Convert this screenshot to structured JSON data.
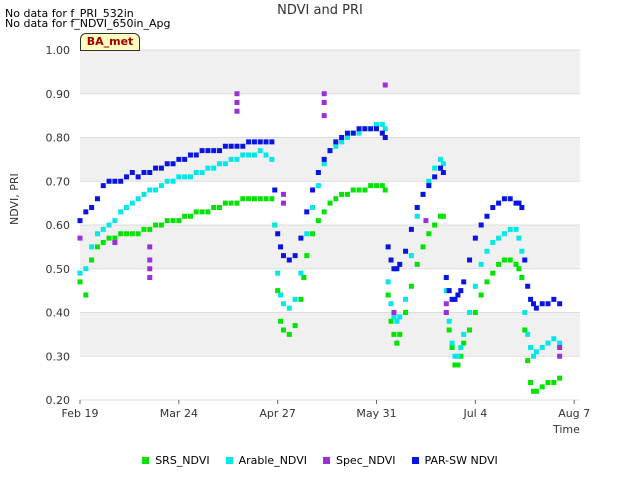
{
  "notes": [
    "No data for f_PRI_532in",
    "No data for f_NDVI_650in_Apg"
  ],
  "badge": "BA_met",
  "chart_data": {
    "type": "scatter",
    "title": "NDVI and PRI",
    "xlabel": "Time",
    "ylabel": "NDVI, PRI",
    "ylim": [
      0.2,
      1.0
    ],
    "yticks": [
      "0.20",
      "0.30",
      "0.40",
      "0.50",
      "0.60",
      "0.70",
      "0.80",
      "0.90",
      "1.00"
    ],
    "xticks": [
      "Feb 19",
      "Mar 24",
      "Apr 27",
      "May 31",
      "Jul 4",
      "Aug 7"
    ],
    "x_unit": "days since Feb 19",
    "xlim": [
      0,
      172
    ],
    "grid": true,
    "legend_position": "bottom",
    "series": [
      {
        "name": "SRS_NDVI",
        "color": "#00e400",
        "points": [
          [
            0,
            0.47
          ],
          [
            2,
            0.44
          ],
          [
            4,
            0.52
          ],
          [
            6,
            0.55
          ],
          [
            8,
            0.56
          ],
          [
            10,
            0.57
          ],
          [
            12,
            0.57
          ],
          [
            14,
            0.58
          ],
          [
            16,
            0.58
          ],
          [
            18,
            0.58
          ],
          [
            20,
            0.58
          ],
          [
            22,
            0.59
          ],
          [
            24,
            0.59
          ],
          [
            26,
            0.6
          ],
          [
            28,
            0.6
          ],
          [
            30,
            0.61
          ],
          [
            32,
            0.61
          ],
          [
            34,
            0.61
          ],
          [
            36,
            0.62
          ],
          [
            38,
            0.62
          ],
          [
            40,
            0.63
          ],
          [
            42,
            0.63
          ],
          [
            44,
            0.63
          ],
          [
            46,
            0.64
          ],
          [
            48,
            0.64
          ],
          [
            50,
            0.65
          ],
          [
            52,
            0.65
          ],
          [
            54,
            0.65
          ],
          [
            56,
            0.66
          ],
          [
            58,
            0.66
          ],
          [
            60,
            0.66
          ],
          [
            62,
            0.66
          ],
          [
            64,
            0.66
          ],
          [
            66,
            0.66
          ],
          [
            67,
            0.6
          ],
          [
            68,
            0.45
          ],
          [
            69,
            0.38
          ],
          [
            70,
            0.36
          ],
          [
            72,
            0.35
          ],
          [
            74,
            0.37
          ],
          [
            76,
            0.43
          ],
          [
            77,
            0.48
          ],
          [
            78,
            0.53
          ],
          [
            80,
            0.58
          ],
          [
            82,
            0.61
          ],
          [
            84,
            0.63
          ],
          [
            86,
            0.65
          ],
          [
            88,
            0.66
          ],
          [
            90,
            0.67
          ],
          [
            92,
            0.67
          ],
          [
            94,
            0.68
          ],
          [
            96,
            0.68
          ],
          [
            98,
            0.68
          ],
          [
            100,
            0.69
          ],
          [
            102,
            0.69
          ],
          [
            104,
            0.69
          ],
          [
            105,
            0.68
          ],
          [
            106,
            0.44
          ],
          [
            107,
            0.38
          ],
          [
            108,
            0.35
          ],
          [
            109,
            0.33
          ],
          [
            110,
            0.35
          ],
          [
            112,
            0.4
          ],
          [
            114,
            0.46
          ],
          [
            116,
            0.51
          ],
          [
            118,
            0.55
          ],
          [
            120,
            0.58
          ],
          [
            122,
            0.6
          ],
          [
            124,
            0.62
          ],
          [
            125,
            0.62
          ],
          [
            126,
            0.4
          ],
          [
            127,
            0.36
          ],
          [
            128,
            0.32
          ],
          [
            129,
            0.28
          ],
          [
            130,
            0.28
          ],
          [
            131,
            0.3
          ],
          [
            132,
            0.33
          ],
          [
            134,
            0.36
          ],
          [
            136,
            0.4
          ],
          [
            138,
            0.44
          ],
          [
            140,
            0.47
          ],
          [
            142,
            0.49
          ],
          [
            144,
            0.51
          ],
          [
            146,
            0.52
          ],
          [
            148,
            0.52
          ],
          [
            150,
            0.51
          ],
          [
            151,
            0.5
          ],
          [
            152,
            0.48
          ],
          [
            153,
            0.36
          ],
          [
            154,
            0.29
          ],
          [
            155,
            0.24
          ],
          [
            156,
            0.22
          ],
          [
            157,
            0.22
          ],
          [
            159,
            0.23
          ],
          [
            161,
            0.24
          ],
          [
            163,
            0.24
          ],
          [
            165,
            0.25
          ]
        ]
      },
      {
        "name": "Arable_NDVI",
        "color": "#00e8e8",
        "points": [
          [
            0,
            0.49
          ],
          [
            2,
            0.5
          ],
          [
            4,
            0.55
          ],
          [
            6,
            0.58
          ],
          [
            8,
            0.59
          ],
          [
            10,
            0.6
          ],
          [
            12,
            0.61
          ],
          [
            14,
            0.63
          ],
          [
            16,
            0.64
          ],
          [
            18,
            0.65
          ],
          [
            20,
            0.66
          ],
          [
            22,
            0.67
          ],
          [
            24,
            0.68
          ],
          [
            26,
            0.68
          ],
          [
            28,
            0.69
          ],
          [
            30,
            0.7
          ],
          [
            32,
            0.7
          ],
          [
            34,
            0.71
          ],
          [
            36,
            0.71
          ],
          [
            38,
            0.71
          ],
          [
            40,
            0.72
          ],
          [
            42,
            0.72
          ],
          [
            44,
            0.73
          ],
          [
            46,
            0.73
          ],
          [
            48,
            0.74
          ],
          [
            50,
            0.74
          ],
          [
            52,
            0.75
          ],
          [
            54,
            0.75
          ],
          [
            56,
            0.76
          ],
          [
            58,
            0.76
          ],
          [
            60,
            0.76
          ],
          [
            62,
            0.77
          ],
          [
            64,
            0.76
          ],
          [
            66,
            0.75
          ],
          [
            67,
            0.6
          ],
          [
            68,
            0.49
          ],
          [
            69,
            0.44
          ],
          [
            70,
            0.42
          ],
          [
            72,
            0.41
          ],
          [
            74,
            0.43
          ],
          [
            76,
            0.49
          ],
          [
            78,
            0.58
          ],
          [
            80,
            0.64
          ],
          [
            82,
            0.69
          ],
          [
            84,
            0.74
          ],
          [
            86,
            0.77
          ],
          [
            88,
            0.78
          ],
          [
            90,
            0.79
          ],
          [
            92,
            0.8
          ],
          [
            94,
            0.81
          ],
          [
            96,
            0.81
          ],
          [
            98,
            0.82
          ],
          [
            100,
            0.82
          ],
          [
            102,
            0.83
          ],
          [
            104,
            0.83
          ],
          [
            105,
            0.82
          ],
          [
            106,
            0.47
          ],
          [
            107,
            0.42
          ],
          [
            108,
            0.39
          ],
          [
            109,
            0.38
          ],
          [
            110,
            0.39
          ],
          [
            112,
            0.43
          ],
          [
            114,
            0.53
          ],
          [
            116,
            0.62
          ],
          [
            118,
            0.67
          ],
          [
            120,
            0.7
          ],
          [
            122,
            0.73
          ],
          [
            124,
            0.75
          ],
          [
            125,
            0.74
          ],
          [
            126,
            0.45
          ],
          [
            127,
            0.38
          ],
          [
            128,
            0.33
          ],
          [
            129,
            0.3
          ],
          [
            130,
            0.3
          ],
          [
            131,
            0.32
          ],
          [
            132,
            0.35
          ],
          [
            134,
            0.4
          ],
          [
            136,
            0.46
          ],
          [
            138,
            0.51
          ],
          [
            140,
            0.54
          ],
          [
            142,
            0.56
          ],
          [
            144,
            0.57
          ],
          [
            146,
            0.58
          ],
          [
            148,
            0.59
          ],
          [
            150,
            0.59
          ],
          [
            151,
            0.57
          ],
          [
            152,
            0.54
          ],
          [
            153,
            0.4
          ],
          [
            154,
            0.35
          ],
          [
            155,
            0.32
          ],
          [
            156,
            0.3
          ],
          [
            157,
            0.31
          ],
          [
            159,
            0.32
          ],
          [
            161,
            0.33
          ],
          [
            163,
            0.34
          ],
          [
            165,
            0.33
          ]
        ]
      },
      {
        "name": "Spec_NDVI",
        "color": "#9b30d9",
        "points": [
          [
            0,
            0.57
          ],
          [
            12,
            0.56
          ],
          [
            24,
            0.55
          ],
          [
            24,
            0.48
          ],
          [
            24,
            0.5
          ],
          [
            24,
            0.52
          ],
          [
            54,
            0.88
          ],
          [
            54,
            0.86
          ],
          [
            54,
            0.9
          ],
          [
            70,
            0.67
          ],
          [
            70,
            0.65
          ],
          [
            84,
            0.9
          ],
          [
            84,
            0.88
          ],
          [
            84,
            0.85
          ],
          [
            105,
            0.92
          ],
          [
            108,
            0.4
          ],
          [
            119,
            0.61
          ],
          [
            126,
            0.4
          ],
          [
            126,
            0.42
          ],
          [
            165,
            0.3
          ],
          [
            165,
            0.32
          ]
        ]
      },
      {
        "name": "PAR-SW NDVI",
        "color": "#0a14e0",
        "points": [
          [
            0,
            0.61
          ],
          [
            2,
            0.63
          ],
          [
            4,
            0.64
          ],
          [
            6,
            0.66
          ],
          [
            8,
            0.69
          ],
          [
            10,
            0.7
          ],
          [
            12,
            0.7
          ],
          [
            14,
            0.7
          ],
          [
            16,
            0.71
          ],
          [
            18,
            0.72
          ],
          [
            20,
            0.71
          ],
          [
            22,
            0.72
          ],
          [
            24,
            0.72
          ],
          [
            26,
            0.73
          ],
          [
            28,
            0.73
          ],
          [
            30,
            0.74
          ],
          [
            32,
            0.74
          ],
          [
            34,
            0.75
          ],
          [
            36,
            0.75
          ],
          [
            38,
            0.76
          ],
          [
            40,
            0.76
          ],
          [
            42,
            0.77
          ],
          [
            44,
            0.77
          ],
          [
            46,
            0.77
          ],
          [
            48,
            0.77
          ],
          [
            50,
            0.78
          ],
          [
            52,
            0.78
          ],
          [
            54,
            0.78
          ],
          [
            56,
            0.78
          ],
          [
            58,
            0.79
          ],
          [
            60,
            0.79
          ],
          [
            62,
            0.79
          ],
          [
            64,
            0.79
          ],
          [
            66,
            0.79
          ],
          [
            67,
            0.68
          ],
          [
            68,
            0.58
          ],
          [
            69,
            0.55
          ],
          [
            70,
            0.53
          ],
          [
            72,
            0.52
          ],
          [
            74,
            0.53
          ],
          [
            76,
            0.57
          ],
          [
            78,
            0.63
          ],
          [
            80,
            0.68
          ],
          [
            82,
            0.72
          ],
          [
            84,
            0.75
          ],
          [
            86,
            0.77
          ],
          [
            88,
            0.79
          ],
          [
            90,
            0.8
          ],
          [
            92,
            0.81
          ],
          [
            94,
            0.81
          ],
          [
            96,
            0.82
          ],
          [
            98,
            0.82
          ],
          [
            100,
            0.82
          ],
          [
            102,
            0.82
          ],
          [
            104,
            0.81
          ],
          [
            105,
            0.8
          ],
          [
            106,
            0.55
          ],
          [
            107,
            0.52
          ],
          [
            108,
            0.5
          ],
          [
            109,
            0.5
          ],
          [
            110,
            0.51
          ],
          [
            112,
            0.54
          ],
          [
            114,
            0.59
          ],
          [
            116,
            0.64
          ],
          [
            118,
            0.67
          ],
          [
            120,
            0.69
          ],
          [
            122,
            0.71
          ],
          [
            124,
            0.73
          ],
          [
            125,
            0.72
          ],
          [
            126,
            0.48
          ],
          [
            127,
            0.45
          ],
          [
            128,
            0.43
          ],
          [
            129,
            0.43
          ],
          [
            130,
            0.44
          ],
          [
            131,
            0.45
          ],
          [
            132,
            0.47
          ],
          [
            134,
            0.52
          ],
          [
            136,
            0.57
          ],
          [
            138,
            0.6
          ],
          [
            140,
            0.62
          ],
          [
            142,
            0.64
          ],
          [
            144,
            0.65
          ],
          [
            146,
            0.66
          ],
          [
            148,
            0.66
          ],
          [
            150,
            0.65
          ],
          [
            151,
            0.65
          ],
          [
            152,
            0.64
          ],
          [
            153,
            0.52
          ],
          [
            154,
            0.46
          ],
          [
            155,
            0.43
          ],
          [
            156,
            0.42
          ],
          [
            157,
            0.41
          ],
          [
            159,
            0.42
          ],
          [
            161,
            0.42
          ],
          [
            163,
            0.43
          ],
          [
            165,
            0.42
          ]
        ]
      }
    ]
  }
}
